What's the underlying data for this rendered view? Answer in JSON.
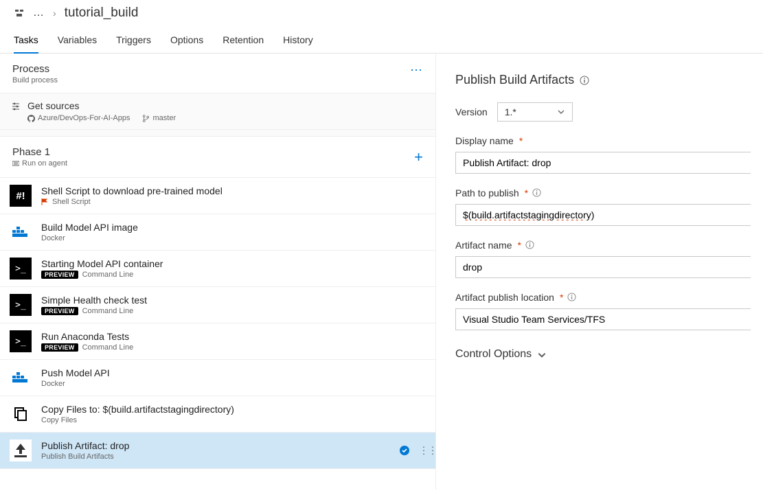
{
  "breadcrumb": {
    "ellipsis": "…",
    "title": "tutorial_build"
  },
  "tabs": [
    "Tasks",
    "Variables",
    "Triggers",
    "Options",
    "Retention",
    "History"
  ],
  "active_tab_index": 0,
  "process": {
    "title": "Process",
    "subtitle": "Build process"
  },
  "get_sources": {
    "title": "Get sources",
    "repo": "Azure/DevOps-For-AI-Apps",
    "branch": "master"
  },
  "phase": {
    "title": "Phase 1",
    "subtitle": "Run on agent"
  },
  "tasks": [
    {
      "icon": "hash",
      "title": "Shell Script to download pre-trained model",
      "sub": "Shell Script",
      "preview": false,
      "flag": true
    },
    {
      "icon": "docker",
      "title": "Build Model API image",
      "sub": "Docker",
      "preview": false
    },
    {
      "icon": "cmd",
      "title": "Starting Model API container",
      "sub": "Command Line",
      "preview": true
    },
    {
      "icon": "cmd",
      "title": "Simple Health check test",
      "sub": "Command Line",
      "preview": true
    },
    {
      "icon": "cmd",
      "title": "Run Anaconda Tests",
      "sub": "Command Line",
      "preview": true
    },
    {
      "icon": "docker",
      "title": "Push Model API",
      "sub": "Docker",
      "preview": false
    },
    {
      "icon": "copy",
      "title": "Copy Files to: $(build.artifactstagingdirectory)",
      "sub": "Copy Files",
      "preview": false
    },
    {
      "icon": "publish",
      "title": "Publish Artifact: drop",
      "sub": "Publish Build Artifacts",
      "preview": false,
      "selected": true,
      "check": true
    }
  ],
  "preview_badge": "PREVIEW",
  "panel": {
    "title": "Publish Build Artifacts",
    "version_label": "Version",
    "version_value": "1.*",
    "fields": {
      "display_name": {
        "label": "Display name",
        "value": "Publish Artifact: drop"
      },
      "path": {
        "label": "Path to publish",
        "value": "$(build.artifactstagingdirectory)"
      },
      "artifact": {
        "label": "Artifact name",
        "value": "drop"
      },
      "location": {
        "label": "Artifact publish location",
        "value": "Visual Studio Team Services/TFS"
      }
    },
    "control_options": "Control Options"
  }
}
